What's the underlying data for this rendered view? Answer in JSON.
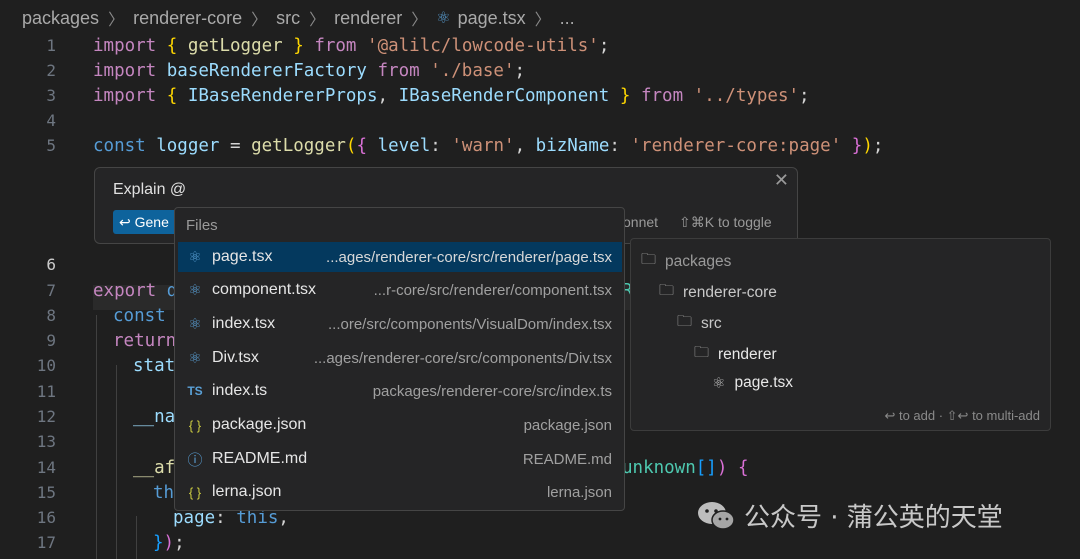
{
  "breadcrumb": {
    "items": [
      "packages",
      "renderer-core",
      "src",
      "renderer",
      "page.tsx",
      "..."
    ]
  },
  "editor": {
    "line_numbers": [
      "1",
      "2",
      "3",
      "4",
      "5",
      "6",
      "7",
      "8",
      "9",
      "10",
      "11",
      "12",
      "13",
      "14",
      "15",
      "16",
      "17"
    ],
    "active_line": "6",
    "line1": [
      "import",
      "{",
      "getLogger",
      "}",
      "from",
      "'@alilc/lowcode-utils'",
      ";"
    ],
    "line2": [
      "import",
      "baseRendererFactory",
      "from",
      "'./base'",
      ";"
    ],
    "line3": [
      "import",
      "{",
      "IBaseRendererProps",
      ",",
      "IBaseRenderComponent",
      "}",
      "from",
      "'../types'",
      ";"
    ],
    "line5": [
      "const",
      "logger",
      "=",
      "getLogger",
      "(",
      "{",
      "level",
      ":",
      "'warn'",
      ",",
      "bizName",
      ":",
      "'renderer-core:page'",
      "}",
      ")",
      ";"
    ],
    "line7": [
      "export",
      "d",
      "R"
    ],
    "line8": [
      "const"
    ],
    "line9": [
      "return"
    ],
    "line10": [
      "stat"
    ],
    "line12": [
      "__na"
    ],
    "line14": [
      "__af",
      "unknown",
      "[]",
      ")",
      "{"
    ],
    "line15": [
      "th"
    ],
    "line16": [
      "page",
      ":",
      "this",
      ","
    ],
    "line17": [
      "}",
      ")",
      ";"
    ]
  },
  "inline_chat": {
    "title": "Explain @",
    "generate_button": "↩ Gene",
    "model_label": "onnet",
    "toggle_hint": "⇧⌘K to toggle",
    "close_glyph": "✕"
  },
  "files_popup": {
    "header": "Files",
    "items": [
      {
        "icon": "react-icon",
        "name": "page.tsx",
        "path": "...ages/renderer-core/src/renderer/page.tsx",
        "selected": true
      },
      {
        "icon": "react-icon",
        "name": "component.tsx",
        "path": "...r-core/src/renderer/component.tsx"
      },
      {
        "icon": "react-icon",
        "name": "index.tsx",
        "path": "...ore/src/components/VisualDom/index.tsx"
      },
      {
        "icon": "react-icon",
        "name": "Div.tsx",
        "path": "...ages/renderer-core/src/components/Div.tsx"
      },
      {
        "icon": "ts-icon",
        "name": "index.ts",
        "path": "packages/renderer-core/src/index.ts"
      },
      {
        "icon": "json-icon",
        "name": "package.json",
        "path": "package.json"
      },
      {
        "icon": "info-icon",
        "name": "README.md",
        "path": "README.md"
      },
      {
        "icon": "json-icon",
        "name": "lerna.json",
        "path": "lerna.json"
      }
    ]
  },
  "tree_panel": {
    "nodes": [
      "packages",
      "renderer-core",
      "src",
      "renderer",
      "page.tsx"
    ],
    "hint": "↩ to add · ⇧↩ to multi-add"
  },
  "watermark": {
    "text": "公众号 · 蒲公英的天堂"
  },
  "colors": {
    "background": "#1f1f1f",
    "selection": "#04395e",
    "button": "#0e639c"
  }
}
